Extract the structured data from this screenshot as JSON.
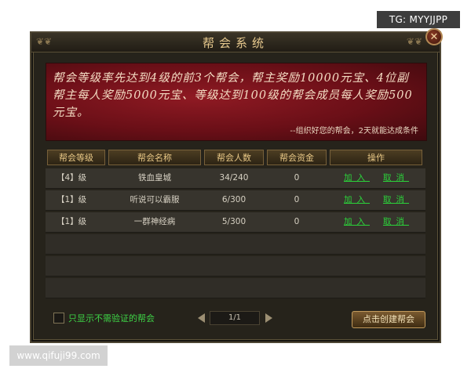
{
  "watermarks": {
    "tg": "TG: MYYJJPP",
    "site": "www.qifuji99.com"
  },
  "window": {
    "title": "帮会系统",
    "close_glyph": "✕",
    "close_icon": "close-icon"
  },
  "banner": {
    "text": "帮会等级率先达到4级的前3个帮会，帮主奖励10000元宝、4位副帮主每人奖励5000元宝、等级达到100级的帮会成员每人奖励500元宝。",
    "note": "--组织好您的帮会，2天就能达成条件"
  },
  "table": {
    "headers": [
      "帮会等级",
      "帮会名称",
      "帮会人数",
      "帮会资金",
      "操作"
    ],
    "rows": [
      {
        "level": "【4】级",
        "name": "铁血皇城",
        "members": "34/240",
        "funds": "0",
        "join": "加入",
        "cancel": "取消"
      },
      {
        "level": "【1】级",
        "name": "听说可以霸服",
        "members": "6/300",
        "funds": "0",
        "join": "加入",
        "cancel": "取消"
      },
      {
        "level": "【1】级",
        "name": "一群神经病",
        "members": "5/300",
        "funds": "0",
        "join": "加入",
        "cancel": "取消"
      }
    ]
  },
  "footer": {
    "checkbox_label": "只显示不需验证的帮会",
    "checked": false,
    "page": "1/1",
    "create_button": "点击创建帮会"
  },
  "colors": {
    "accent_gold": "#e9c886",
    "link_green": "#2bd43a",
    "banner_red": "#8f1a23"
  }
}
